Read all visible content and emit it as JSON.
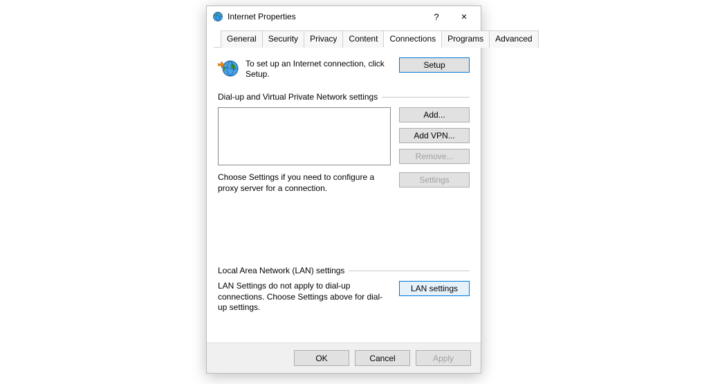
{
  "titlebar": {
    "title": "Internet Properties",
    "help_label": "?",
    "close_label": "✕"
  },
  "tabs": {
    "items": [
      {
        "label": "General"
      },
      {
        "label": "Security"
      },
      {
        "label": "Privacy"
      },
      {
        "label": "Content"
      },
      {
        "label": "Connections"
      },
      {
        "label": "Programs"
      },
      {
        "label": "Advanced"
      }
    ],
    "active_index": 4
  },
  "intro": {
    "text": "To set up an Internet connection, click Setup.",
    "setup_label": "Setup"
  },
  "dialup_group": {
    "header": "Dial-up and Virtual Private Network settings",
    "add_label": "Add...",
    "add_vpn_label": "Add VPN...",
    "remove_label": "Remove...",
    "proxy_text": "Choose Settings if you need to configure a proxy server for a connection.",
    "settings_label": "Settings"
  },
  "lan_group": {
    "header": "Local Area Network (LAN) settings",
    "text": "LAN Settings do not apply to dial-up connections. Choose Settings above for dial-up settings.",
    "lan_settings_label": "LAN settings"
  },
  "footer": {
    "ok_label": "OK",
    "cancel_label": "Cancel",
    "apply_label": "Apply"
  }
}
